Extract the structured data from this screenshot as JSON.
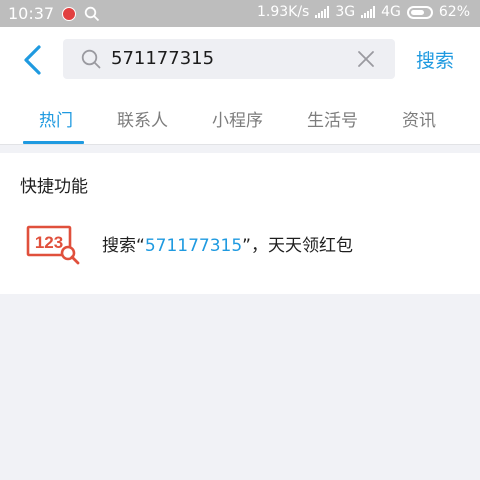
{
  "status_bar": {
    "time": "10:37",
    "net_speed": "1.93K/s",
    "network1": "3G",
    "network2": "4G",
    "battery": "62%"
  },
  "search": {
    "query": "571177315",
    "search_button": "搜索"
  },
  "tabs": [
    {
      "label": "热门",
      "active": true
    },
    {
      "label": "联系人",
      "active": false
    },
    {
      "label": "小程序",
      "active": false
    },
    {
      "label": "生活号",
      "active": false
    },
    {
      "label": "资讯",
      "active": false
    }
  ],
  "quick": {
    "title": "快捷功能",
    "icon_text": "123",
    "item_prefix": "搜索“",
    "item_number": "571177315",
    "item_suffix": "”，天天领红包"
  },
  "colors": {
    "accent": "#1f9ae0",
    "icon_red": "#e0503c",
    "statusbar": "#bdbdbd",
    "background": "#f1f2f6"
  }
}
